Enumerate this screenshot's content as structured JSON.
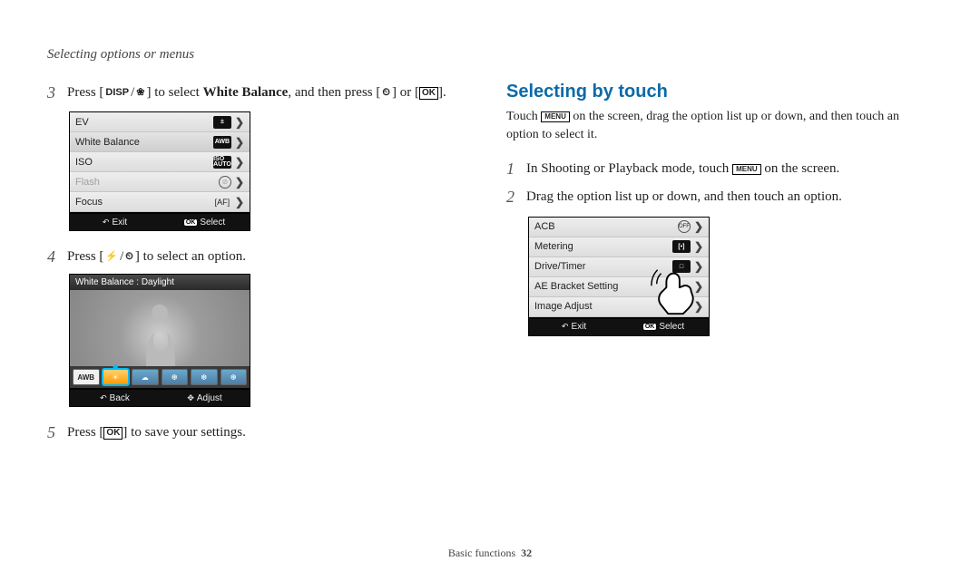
{
  "header": "Selecting options or menus",
  "left": {
    "step3_a": "Press [",
    "step3_disp": "DISP",
    "step3_b": "/",
    "step3_flower": "❀",
    "step3_c": "] to select ",
    "step3_bold": "White Balance",
    "step3_d": ", and then press [",
    "step3_timer": "⏲",
    "step3_e": "] or [",
    "step3_ok": "OK",
    "step3_f": "].",
    "menu": {
      "rows": [
        {
          "label": "EV",
          "icon": "±",
          "chev": "❯"
        },
        {
          "label": "White Balance",
          "icon": "AWB",
          "chev": "❯",
          "selected": true
        },
        {
          "label": "ISO",
          "icon": "ISO\nAUTO",
          "chev": "❯"
        },
        {
          "label": "Flash",
          "icon": "⊘",
          "chev": "❯",
          "disabled": true
        },
        {
          "label": "Focus",
          "icon": "[AF]",
          "chev": "❯"
        }
      ],
      "exit": "Exit",
      "select": "Select",
      "ok": "OK"
    },
    "step4_a": "Press [",
    "step4_flash": "⚡",
    "step4_b": "/",
    "step4_timer": "⏲",
    "step4_c": "] to select an option.",
    "wb": {
      "title": "White Balance : Daylight",
      "chips": [
        "AWB",
        "☀",
        "☁",
        "❆",
        "❆",
        "❆"
      ],
      "back": "Back",
      "adjust": "Adjust"
    },
    "step5_a": "Press [",
    "step5_ok": "OK",
    "step5_b": "] to save your settings."
  },
  "right": {
    "heading": "Selecting by touch",
    "body_a": "Touch ",
    "body_menu": "MENU",
    "body_b": " on the screen, drag the option list up or down, and then touch an option to select it.",
    "step1_a": "In Shooting or Playback mode, touch ",
    "step1_menu": "MENU",
    "step1_b": " on the screen.",
    "step2": "Drag the option list up or down, and then touch an option.",
    "menu2": {
      "rows": [
        {
          "label": "ACB",
          "icon": "OFF",
          "circle": true,
          "chev": "❯"
        },
        {
          "label": "Metering",
          "icon": "[•]",
          "box": true,
          "chev": "❯"
        },
        {
          "label": "Drive/Timer",
          "icon": "□",
          "box": true,
          "chev": "❯"
        },
        {
          "label": "AE Bracket Setting",
          "icon": "",
          "chev": "❯"
        },
        {
          "label": "Image Adjust",
          "icon": "",
          "chev": "❯"
        }
      ],
      "exit": "Exit",
      "select": "Select",
      "ok": "OK"
    }
  },
  "footer": {
    "section": "Basic functions",
    "page": "32"
  }
}
